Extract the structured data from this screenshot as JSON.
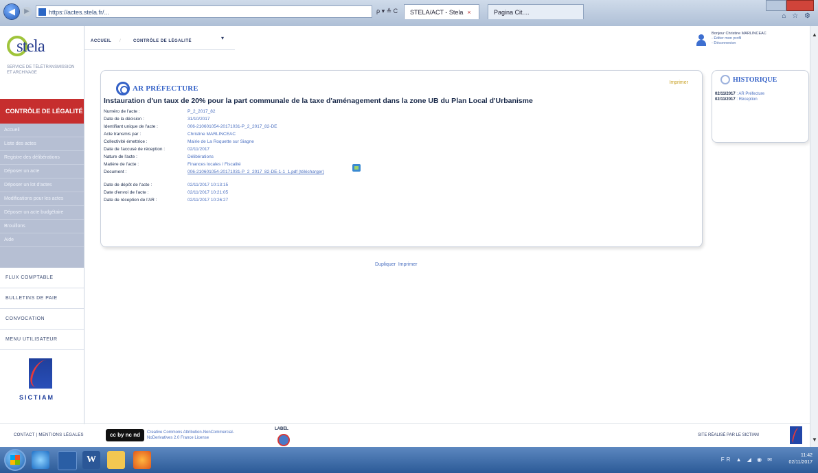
{
  "browser": {
    "address": "https://actes.stela.fr/...",
    "address_tools": "ρ ▾ ≙ C",
    "tabs": [
      {
        "label": "STELA/ACT - Stela"
      },
      {
        "label": "Pagina Cit...."
      }
    ],
    "home_icons": "⌂ ☆ ⚙"
  },
  "logo": {
    "name": "stela",
    "subtitle": "SERVICE DE TÉLÉTRANSMISSION ET ARCHIVAGE"
  },
  "sidebar": {
    "header": "CONTRÔLE DE LÉGALITÉ",
    "items": [
      {
        "label": "Accueil"
      },
      {
        "label": "Liste des actes"
      },
      {
        "label": "Registre des délibérations"
      },
      {
        "label": "Déposer un acte"
      },
      {
        "label": "Déposer un lot d'actes"
      },
      {
        "label": "Modifications pour les actes"
      },
      {
        "label": "Déposer un acte budgétaire"
      },
      {
        "label": "Brouillons"
      },
      {
        "label": "Aide"
      }
    ],
    "sections": [
      {
        "label": "FLUX COMPTABLE"
      },
      {
        "label": "BULLETINS DE PAIE"
      },
      {
        "label": "CONVOCATION"
      },
      {
        "label": "MENU UTILISATEUR"
      }
    ],
    "partner_logo_text": "SICTIAM"
  },
  "breadcrumb": {
    "home": "ACCUEIL",
    "current": "CONTRÔLE DE LÉGALITÉ"
  },
  "user": {
    "line1": "Bonjour Christine MARLINCEAC",
    "line2": "- Éditer mon profil",
    "line3": "- Déconnexion"
  },
  "card": {
    "heading": "AR PRÉFECTURE",
    "print_link": "Imprimer",
    "title": "Instauration d'un taux de 20% pour la part communale de la taxe d'aménagement dans la zone UB du Plan Local d'Urbanisme",
    "fields": [
      {
        "key": "Numéro de l'acte :",
        "value": "P_2_2017_82"
      },
      {
        "key": "Date de la décision :",
        "value": "31/10/2017"
      },
      {
        "key": "Identifiant unique de l'acte :",
        "value": "006-210601054-20171031-P_2_2017_82-DE"
      },
      {
        "key": "Acte transmis par :",
        "value": "Christine MARLINCEAC"
      },
      {
        "key": "Collectivité émettrice :",
        "value": "Mairie de La Roquette sur Siagne"
      },
      {
        "key": "Date de l'accusé de réception :",
        "value": "02/11/2017"
      },
      {
        "key": "Nature de l'acte :",
        "value": "Délibérations"
      },
      {
        "key": "Matière de l'acte :",
        "value": "Finances locales / Fiscalité"
      },
      {
        "key": "Document :",
        "value": "006-210601054-20171031-P_2_2017_82-DE-1-1_1.pdf (télécharger)"
      },
      {
        "key": "Date de dépôt de l'acte :",
        "value": "02/11/2017 10:13:15"
      },
      {
        "key": "Date d'envoi de l'acte :",
        "value": "02/11/2017 10:21:05"
      },
      {
        "key": "Date de réception de l'AR :",
        "value": "02/11/2017 10:26:27"
      }
    ]
  },
  "history": {
    "heading": "HISTORIQUE",
    "entries": [
      {
        "date": "02/11/2017",
        "text": ": AR Préfecture"
      },
      {
        "date": "02/11/2017",
        "text": ": Réception"
      }
    ]
  },
  "actions": {
    "a": "Dupliquer",
    "b": "Imprimer"
  },
  "footer": {
    "links": "CONTACT | MENTIONS LÉGALES",
    "cc_badge": "cc by nc nd",
    "cc_line1": "Creative Commons Attribution-NonCommercial-",
    "cc_line2": "NoDerivatives 2.0 France License",
    "ie_badge": "LABEL",
    "right_text": "SITE RÉALISÉ PAR LE SICTIAM"
  },
  "taskbar": {
    "time": "11:42",
    "date": "02/11/2017",
    "tray_icons": "FR ▲ ◢ ◉ ✉"
  }
}
